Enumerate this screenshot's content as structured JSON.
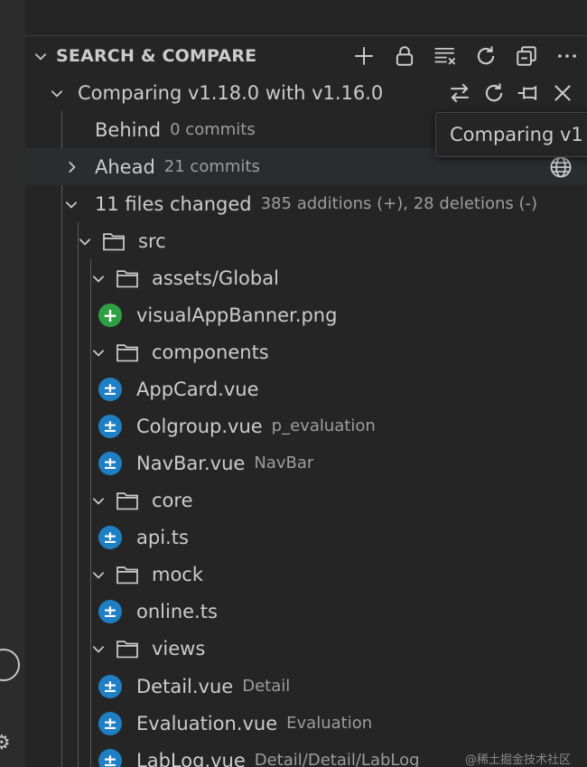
{
  "section": {
    "title": "SEARCH & COMPARE",
    "actions": [
      "add-icon",
      "lock-icon",
      "clear-all-icon",
      "refresh-icon",
      "collapse-all-icon",
      "more-icon"
    ]
  },
  "comparison": {
    "label": "Comparing v1.18.0 with v1.16.0",
    "actions": [
      "swap-icon",
      "refresh-icon",
      "pin-icon",
      "close-icon"
    ]
  },
  "behind": {
    "label": "Behind",
    "desc": "0 commits"
  },
  "ahead": {
    "label": "Ahead",
    "desc": "21 commits"
  },
  "files_changed": {
    "label": "11 files changed",
    "desc": "385 additions (+), 28 deletions (-)"
  },
  "tree": {
    "src": {
      "label": "src"
    },
    "assets": {
      "label": "assets/Global"
    },
    "banner": {
      "label": "visualAppBanner.png",
      "status": "added"
    },
    "components": {
      "label": "components"
    },
    "appcard": {
      "label": "AppCard.vue"
    },
    "colgroup": {
      "label": "Colgroup.vue",
      "desc": "p_evaluation"
    },
    "navbar": {
      "label": "NavBar.vue",
      "desc": "NavBar"
    },
    "core": {
      "label": "core"
    },
    "api": {
      "label": "api.ts"
    },
    "mock": {
      "label": "mock"
    },
    "online": {
      "label": "online.ts"
    },
    "views": {
      "label": "views"
    },
    "detail": {
      "label": "Detail.vue",
      "desc": "Detail"
    },
    "evaluation": {
      "label": "Evaluation.vue",
      "desc": "Evaluation"
    },
    "lablog": {
      "label": "LabLog.vue",
      "desc": "Detail/Detail/LabLog"
    }
  },
  "tooltip": {
    "text": "Comparing v1"
  },
  "status_symbols": {
    "added": "+",
    "modified": "±"
  },
  "colors": {
    "added": "#2ea043",
    "modified": "#1f7fc4",
    "hover_row": "#2a2d2e"
  },
  "watermark": "@稀土掘金技术社区"
}
